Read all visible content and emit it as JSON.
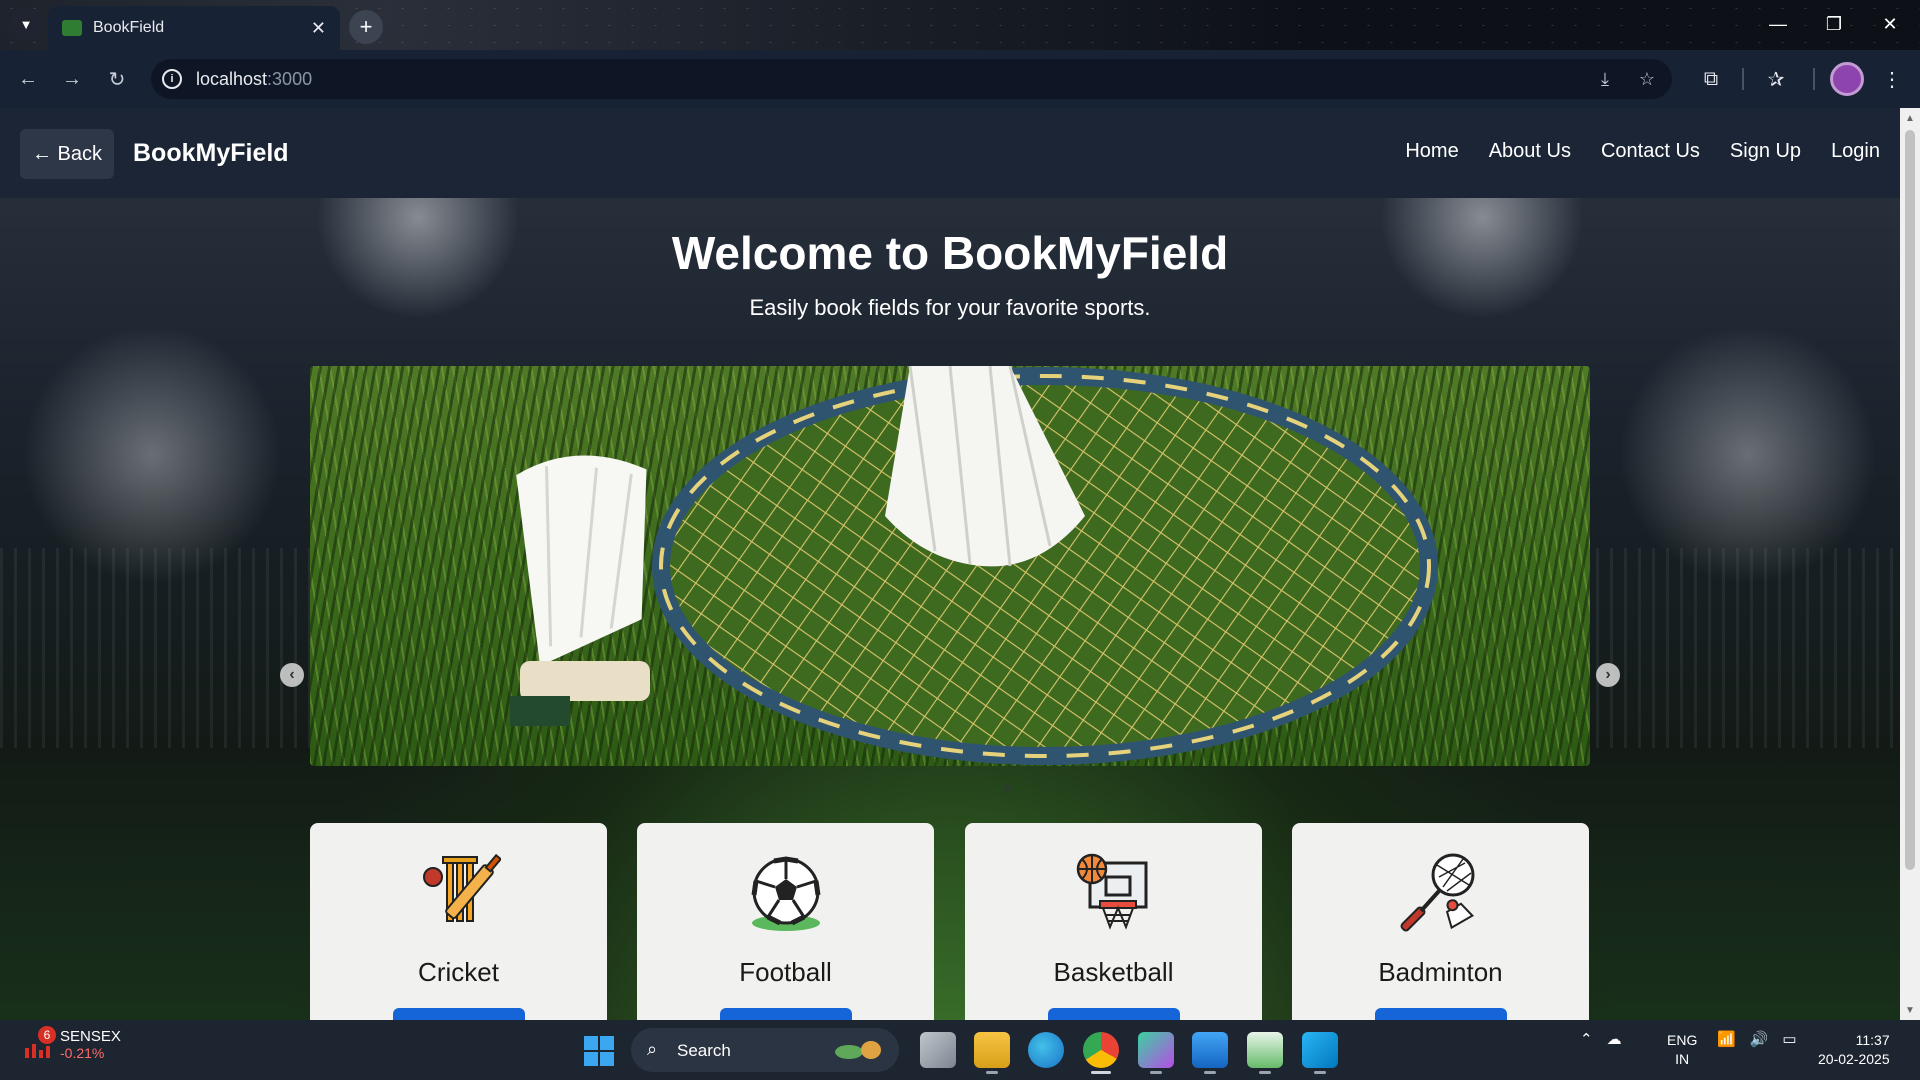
{
  "browser": {
    "tab_title": "BookField",
    "tab_menu_icon": "chevron-down-icon",
    "new_tab_icon": "plus-icon",
    "url_host": "localhost",
    "url_port": ":3000",
    "window_controls": [
      "minimize-icon",
      "restore-icon",
      "close-icon"
    ]
  },
  "navbar": {
    "back_label": "← Back",
    "brand": "BookMyField",
    "links": [
      "Home",
      "About Us",
      "Contact Us",
      "Sign Up",
      "Login"
    ]
  },
  "hero": {
    "title": "Welcome to BookMyField",
    "subtitle": "Easily book fields for your favorite sports."
  },
  "carousel": {
    "prev_icon": "chevron-left-icon",
    "next_icon": "chevron-right-icon"
  },
  "sports": [
    {
      "name": "Cricket",
      "icon": "cricket-icon"
    },
    {
      "name": "Football",
      "icon": "football-icon"
    },
    {
      "name": "Basketball",
      "icon": "basketball-icon"
    },
    {
      "name": "Badminton",
      "icon": "badminton-icon"
    }
  ],
  "taskbar": {
    "ticker_name": "SENSEX",
    "ticker_change": "-0.21%",
    "ticker_badge": "6",
    "search_label": "Search",
    "lang_line1": "ENG",
    "lang_line2": "IN",
    "time": "11:37",
    "date": "20-02-2025"
  },
  "colors": {
    "navbar_bg": "#1b2536",
    "card_button": "#1565d8",
    "accent_green": "#2e7d32"
  }
}
